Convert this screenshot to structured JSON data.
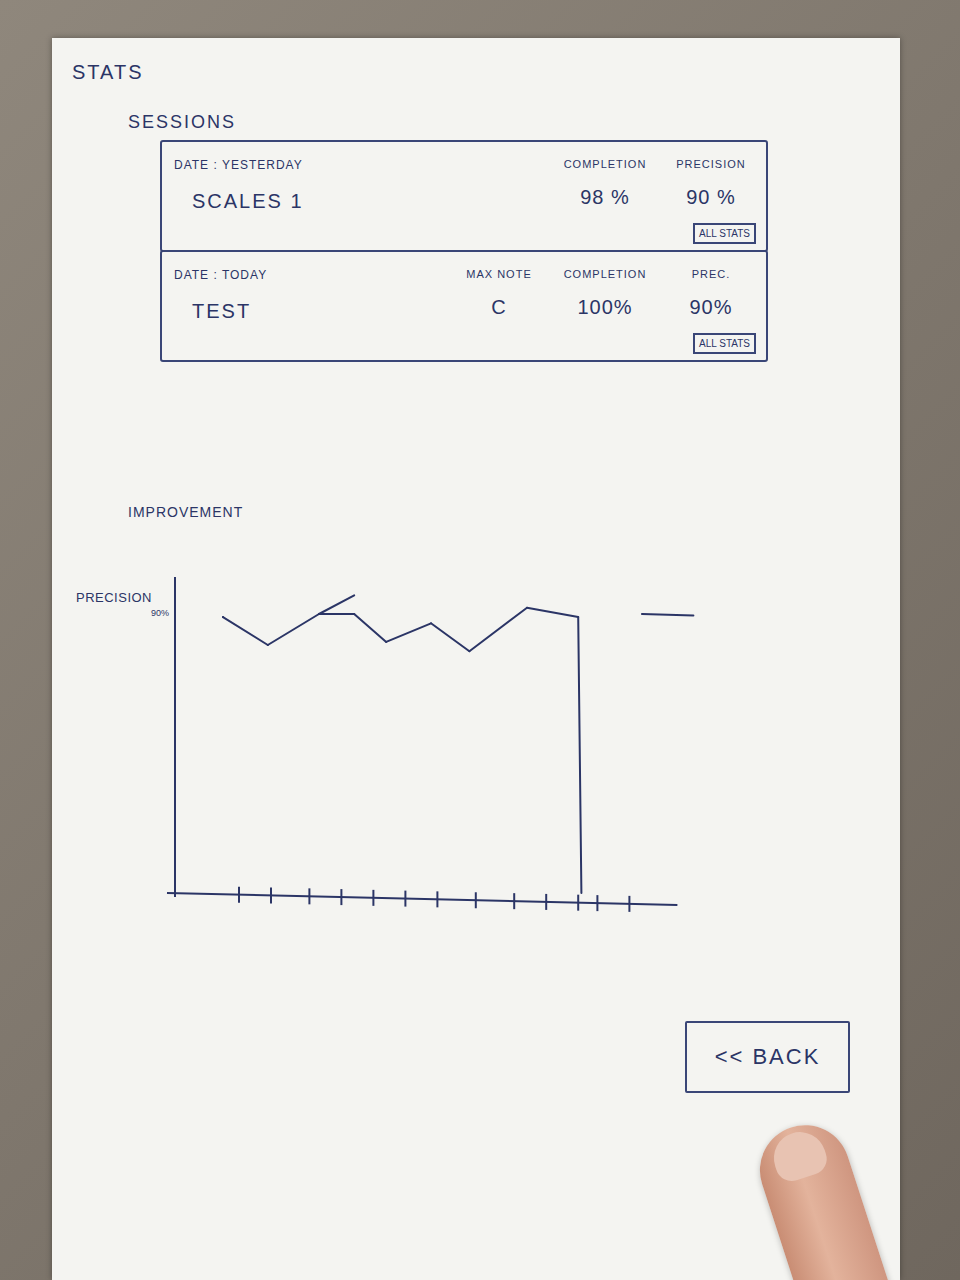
{
  "page": {
    "title": "STATS"
  },
  "sessions": {
    "title": "SESSIONS",
    "items": [
      {
        "date": "DATE : YESTERDAY",
        "name": "SCALES 1",
        "stats": [
          {
            "label": "COMPLETION",
            "value": "98 %"
          },
          {
            "label": "PRECISION",
            "value": "90 %"
          }
        ],
        "button": "ALL STATS"
      },
      {
        "date": "DATE : TODAY",
        "name": "TEST",
        "stats": [
          {
            "label": "MAX NOTE",
            "value": "C"
          },
          {
            "label": "COMPLETION",
            "value": "100%"
          },
          {
            "label": "PREC.",
            "value": "90%"
          }
        ],
        "button": "ALL STATS"
      }
    ]
  },
  "improvement": {
    "title": "IMPROVEMENT",
    "chart": {
      "y_label": "PRECISION",
      "y_ticks": [
        {
          "label": "90%",
          "value": 90
        }
      ],
      "x_ticks": [
        2,
        3,
        4.2,
        5.2,
        6.2,
        7.2,
        8.2,
        9.4,
        10.6,
        11.6,
        12.6,
        13.2,
        14.2
      ],
      "series": [
        {
          "points": [
            [
              1.5,
              89
            ],
            [
              2.9,
              80
            ],
            [
              4.5,
              90
            ],
            [
              5.6,
              90
            ],
            [
              6.6,
              81
            ],
            [
              8,
              87
            ],
            [
              9.2,
              78
            ],
            [
              11,
              92
            ],
            [
              12.6,
              89
            ],
            [
              12.7,
              0
            ]
          ]
        },
        {
          "points": [
            [
              4.5,
              90
            ],
            [
              5.6,
              96
            ]
          ]
        },
        {
          "points": [
            [
              14.6,
              90
            ],
            [
              16.2,
              89.5
            ]
          ]
        }
      ]
    }
  },
  "back_button": "<< BACK"
}
